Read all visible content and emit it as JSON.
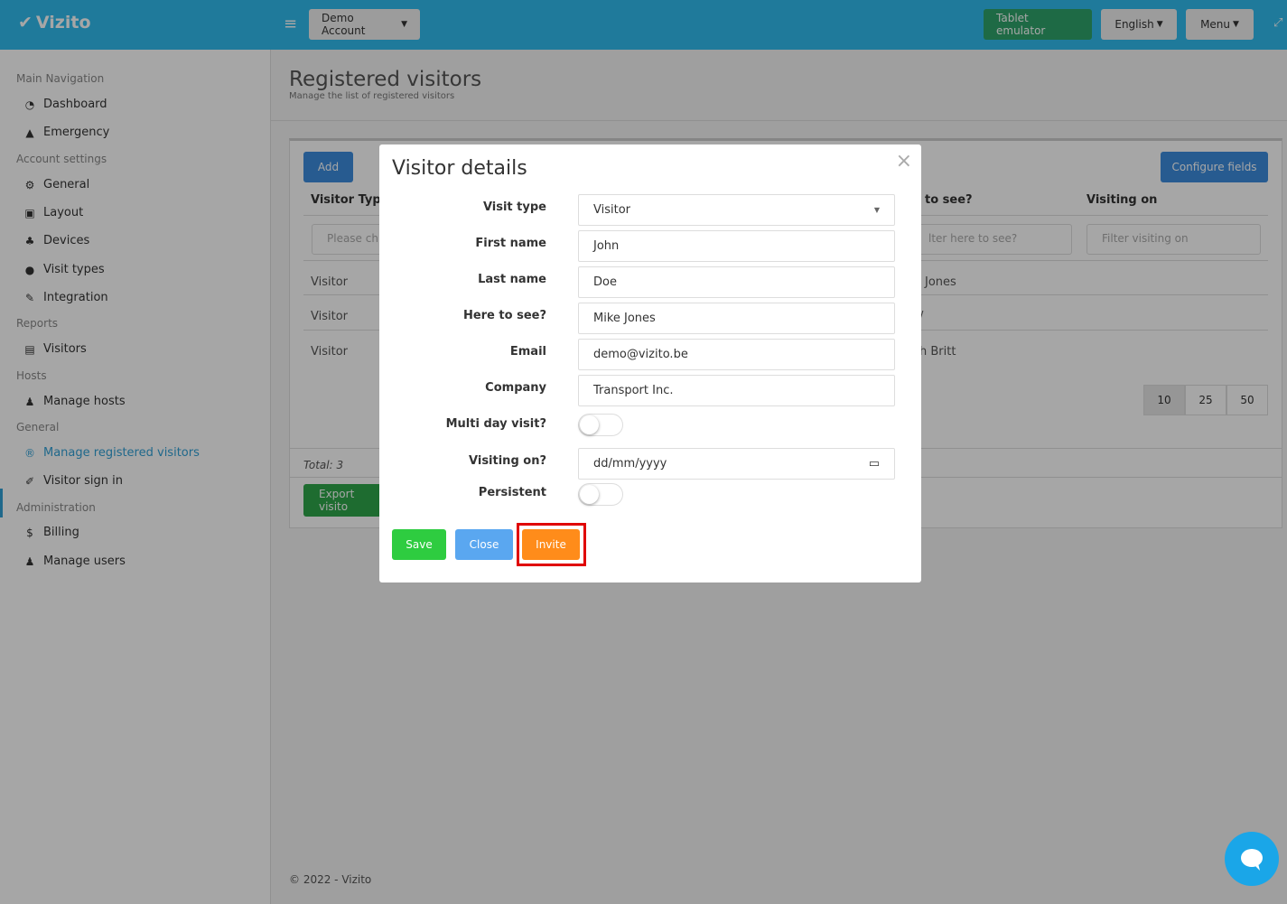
{
  "header": {
    "brand": "Vizito",
    "account": "Demo Account",
    "tablet": "Tablet emulator",
    "language": "English",
    "menu": "Menu"
  },
  "sidebar": {
    "sections": [
      "Main Navigation",
      "Account settings",
      "Reports",
      "Hosts",
      "General",
      "Administration"
    ],
    "items": [
      {
        "label": "Dashboard",
        "icon": "dashboard-icon"
      },
      {
        "label": "Emergency",
        "icon": "warning-icon"
      },
      {
        "label": "General",
        "icon": "gear-icon"
      },
      {
        "label": "Layout",
        "icon": "image-icon"
      },
      {
        "label": "Devices",
        "icon": "sitemap-icon"
      },
      {
        "label": "Visit types",
        "icon": "users-icon"
      },
      {
        "label": "Integration",
        "icon": "plug-icon"
      },
      {
        "label": "Visitors",
        "icon": "book-icon"
      },
      {
        "label": "Manage hosts",
        "icon": "user-icon"
      },
      {
        "label": "Manage registered visitors",
        "icon": "registered-icon"
      },
      {
        "label": "Visitor sign in",
        "icon": "pencil-icon"
      },
      {
        "label": "Billing",
        "icon": "dollar-icon"
      },
      {
        "label": "Manage users",
        "icon": "user-plus-icon"
      }
    ]
  },
  "page": {
    "title": "Registered visitors",
    "subtitle": "Manage the list of registered visitors"
  },
  "table": {
    "add": "Add",
    "configure": "Configure fields",
    "headers": [
      "Visitor Type",
      "to see?",
      "Visiting on"
    ],
    "filters": [
      "Please ch",
      "lter here to see?",
      "Filter visiting on"
    ],
    "rows": [
      [
        "Visitor",
        "Jones"
      ],
      [
        "Visitor",
        "/"
      ],
      [
        "Visitor",
        "h Britt"
      ]
    ],
    "page_sizes": [
      "10",
      "25",
      "50"
    ],
    "total": "Total: 3",
    "export": "Export visito"
  },
  "footer": "© 2022 - Vizito",
  "modal": {
    "title": "Visitor details",
    "close": "×",
    "fields": [
      {
        "label": "Visit type",
        "value": "Visitor"
      },
      {
        "label": "First name",
        "value": "John"
      },
      {
        "label": "Last name",
        "value": "Doe"
      },
      {
        "label": "Here to see?",
        "value": "Mike Jones"
      },
      {
        "label": "Email",
        "value": "demo@vizito.be"
      },
      {
        "label": "Company",
        "value": "Transport Inc."
      }
    ],
    "multi_day_label": "Multi day visit?",
    "multi_day": false,
    "visiting_on_label": "Visiting on?",
    "visiting_on_placeholder": "dd/mm/yyyy",
    "persistent_label": "Persistent",
    "persistent": false,
    "save": "Save",
    "close_btn": "Close",
    "invite": "Invite"
  },
  "colors": {
    "header": "#30bcee",
    "save": "#2ecc40",
    "close": "#5aa7f0",
    "invite": "#ff8c1a",
    "highlight": "#e00000"
  }
}
